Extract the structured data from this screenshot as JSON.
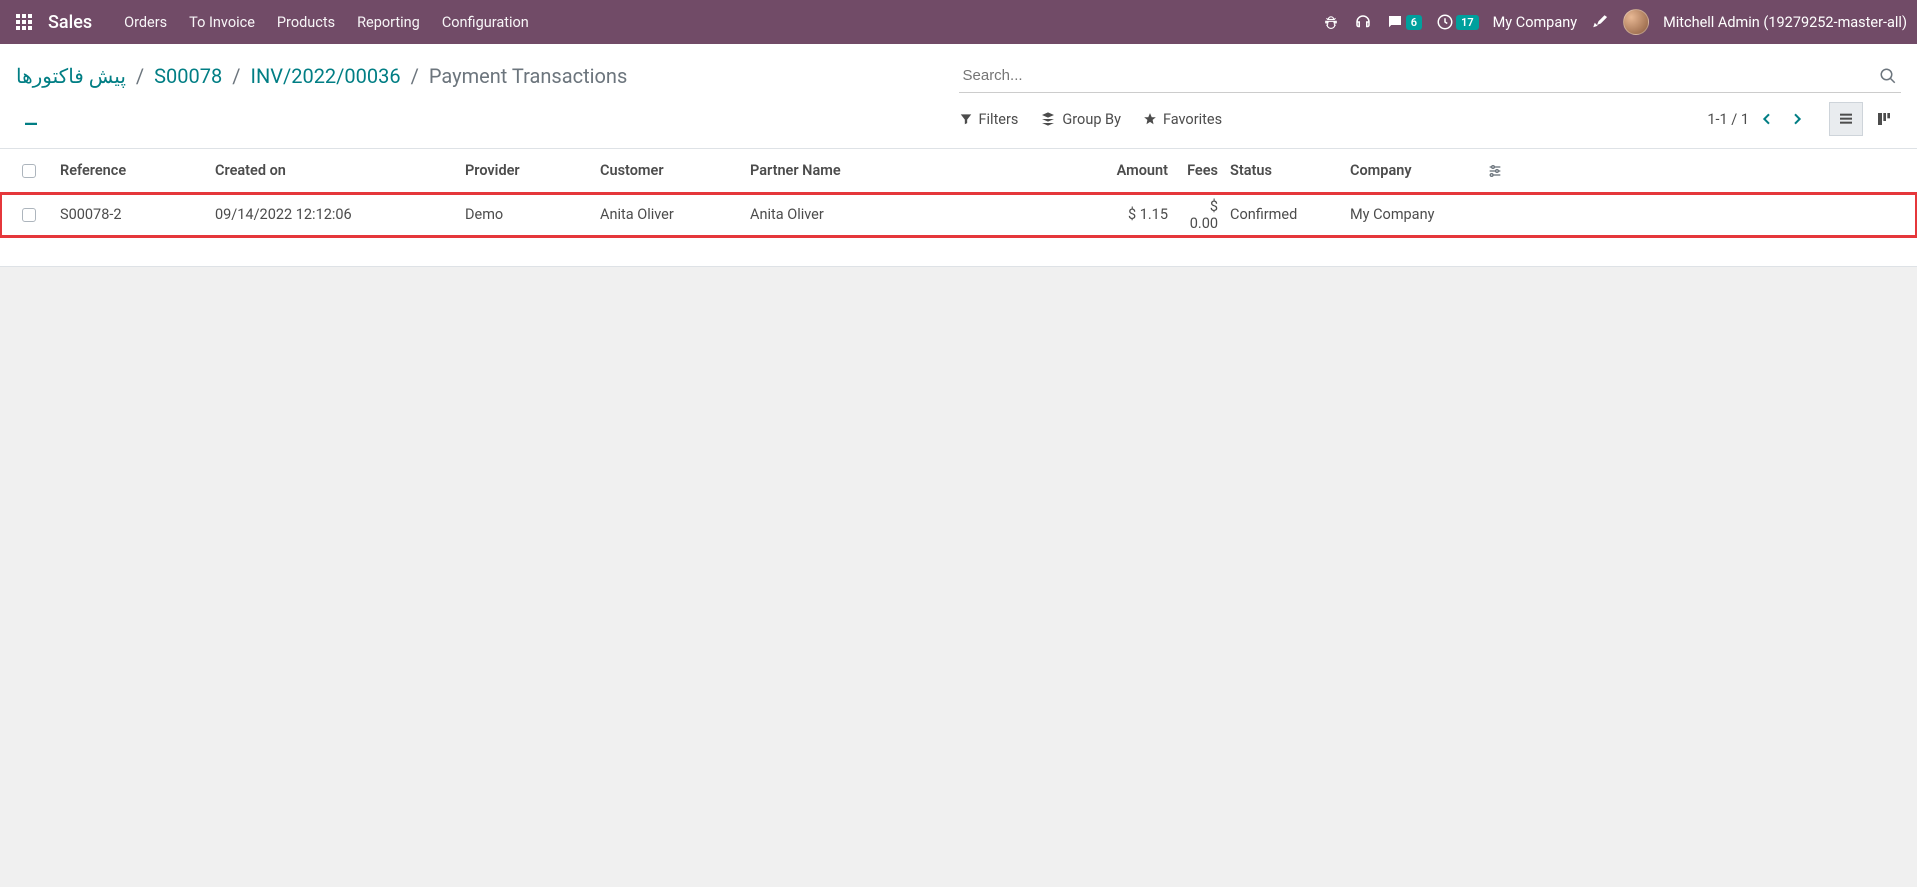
{
  "nav": {
    "brand": "Sales",
    "menu": [
      "Orders",
      "To Invoice",
      "Products",
      "Reporting",
      "Configuration"
    ],
    "messages_badge": "6",
    "activities_badge": "17",
    "company": "My Company",
    "user": "Mitchell Admin (19279252-master-all)"
  },
  "breadcrumb": {
    "items": [
      "پیش فاکتورها",
      "S00078",
      "INV/2022/00036"
    ],
    "current": "Payment Transactions"
  },
  "search": {
    "placeholder": "Search..."
  },
  "toolbar": {
    "filters": "Filters",
    "group_by": "Group By",
    "favorites": "Favorites",
    "pager": "1-1 / 1"
  },
  "table": {
    "headers": {
      "reference": "Reference",
      "created_on": "Created on",
      "provider": "Provider",
      "customer": "Customer",
      "partner_name": "Partner Name",
      "amount": "Amount",
      "fees": "Fees",
      "status": "Status",
      "company": "Company"
    },
    "rows": [
      {
        "reference": "S00078-2",
        "created_on": "09/14/2022 12:12:06",
        "provider": "Demo",
        "customer": "Anita Oliver",
        "partner_name": "Anita Oliver",
        "amount": "$ 1.15",
        "fees": "$ 0.00",
        "status": "Confirmed",
        "company": "My Company"
      }
    ]
  }
}
